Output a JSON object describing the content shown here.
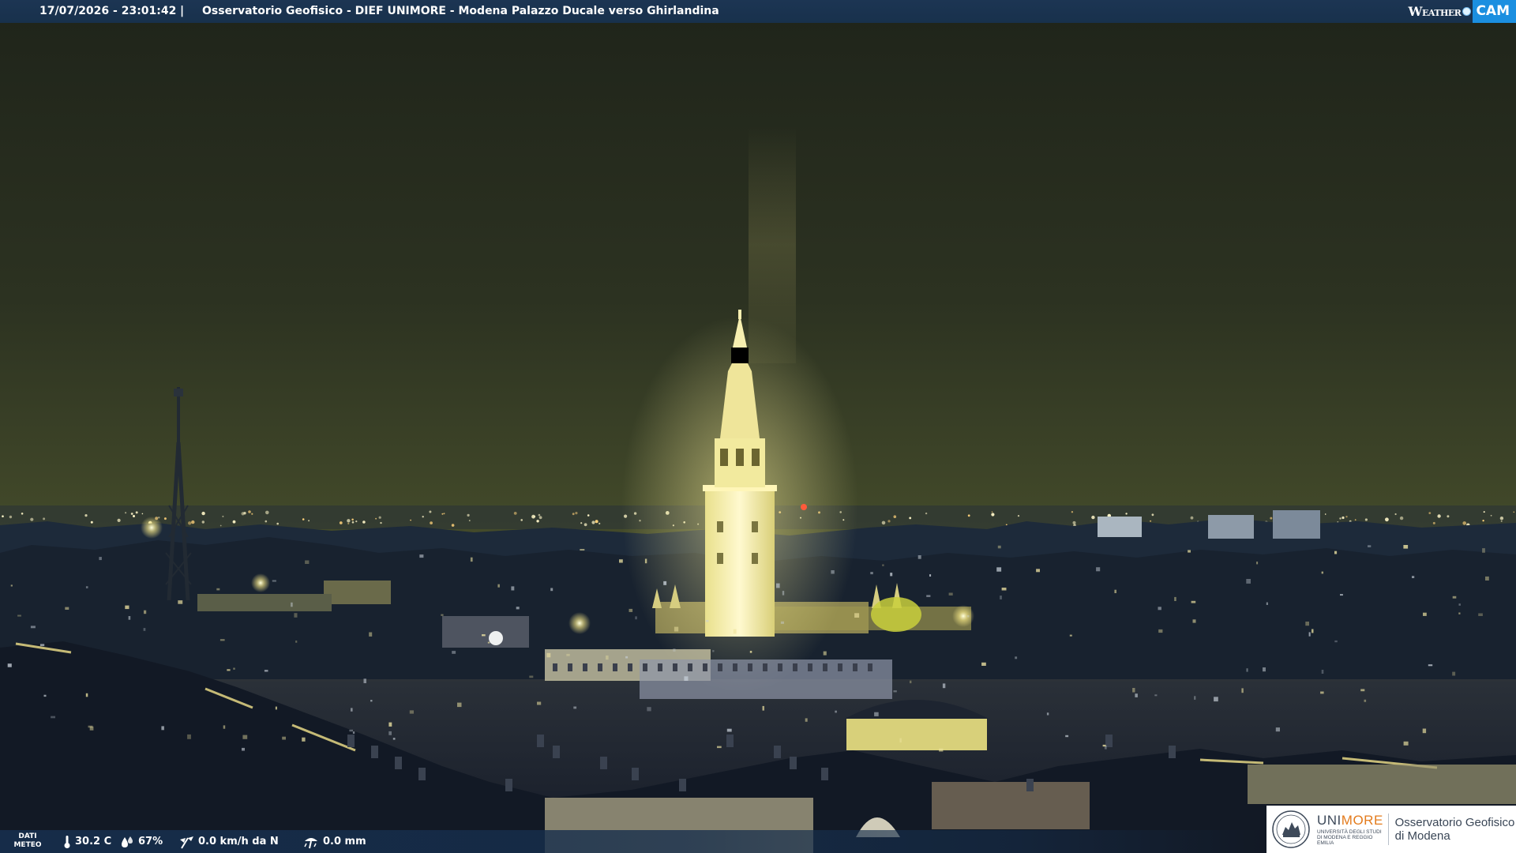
{
  "header": {
    "timestamp": "17/07/2026 - 23:01:42",
    "separator": "|",
    "title": "Osservatorio Geofisico - DIEF UNIMORE - Modena Palazzo Ducale verso Ghirlandina",
    "brand": {
      "word_1": "Weather",
      "word_2": "CAM"
    }
  },
  "meteo": {
    "label_line1": "DATI",
    "label_line2": "METEO",
    "temperature": "30.2 C",
    "humidity": "67%",
    "wind": "0.0 km/h da N",
    "rain": "0.0 mm",
    "icons": [
      "thermometer-icon",
      "humidity-drop-icon",
      "wind-icon",
      "rain-gauge-icon"
    ]
  },
  "institution": {
    "name_uni": "UNI",
    "name_more": "MORE",
    "subtitle": "UNIVERSITÀ DEGLI STUDI DI MODENA E REGGIO EMILIA",
    "observatory_line1": "Osservatorio Geofisico",
    "observatory_line2": "di Modena"
  },
  "colors": {
    "bar_blue": "#18314c",
    "cam_blue": "#1b8fe0",
    "unimore_orange": "#e37b1c",
    "sky_top": "#20251b",
    "sky_horizon": "#4e562e",
    "tower_light": "#fff7c4"
  }
}
